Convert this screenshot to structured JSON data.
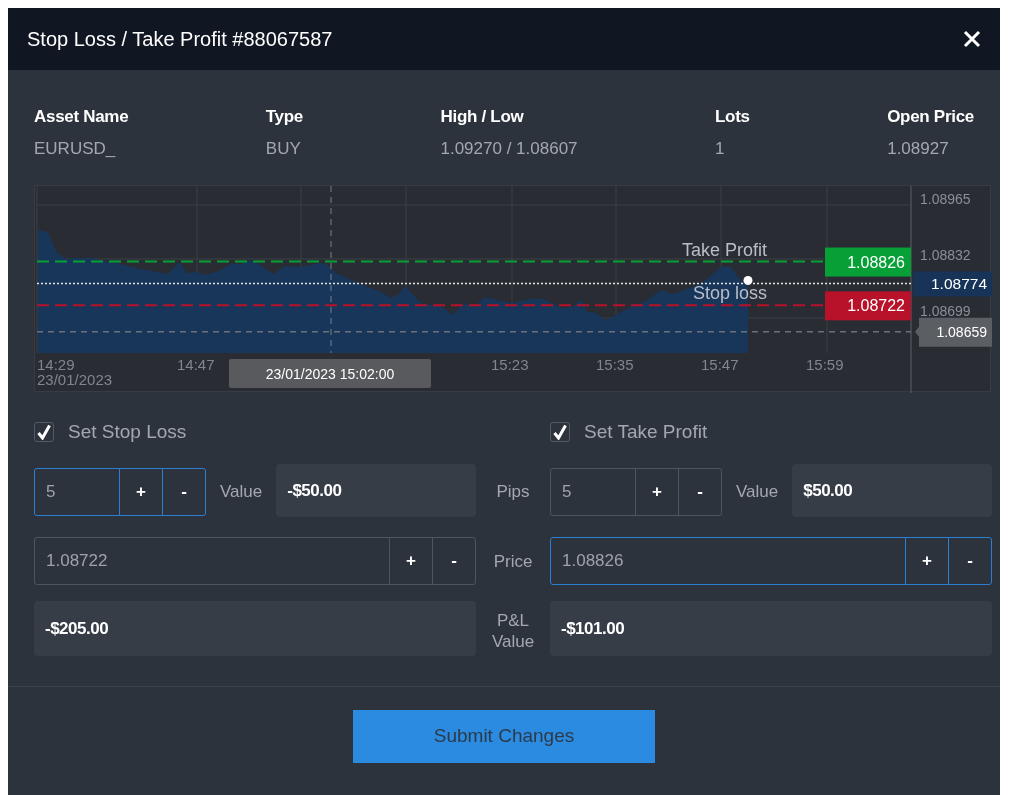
{
  "dialog": {
    "title": "Stop Loss / Take Profit #88067587"
  },
  "summary": [
    {
      "label": "Asset Name",
      "value": "EURUSD_"
    },
    {
      "label": "Type",
      "value": "BUY"
    },
    {
      "label": "High / Low",
      "value": "1.09270 / 1.08607"
    },
    {
      "label": "Lots",
      "value": "1"
    },
    {
      "label": "Open Price",
      "value": "1.08927"
    }
  ],
  "chart": {
    "price_ticks": [
      "1.08965",
      "1.08832",
      "1.08699"
    ],
    "time_ticks": [
      {
        "time": "14:29",
        "date": "23/01/2023"
      },
      {
        "time": "14:47"
      },
      {
        "time": "15:23"
      },
      {
        "time": "15:35"
      },
      {
        "time": "15:47"
      },
      {
        "time": "15:59"
      }
    ],
    "levels": [
      {
        "kind": "take_profit",
        "label": "Take Profit",
        "price": "1.08826",
        "color": "#07a037"
      },
      {
        "kind": "stop_loss",
        "label": "Stop loss",
        "price": "1.08722",
        "color": "#b8112a"
      }
    ],
    "current_price": "1.08774",
    "open_marker": "1.08659",
    "crosshair_time": "23/01/2023 15:02:00"
  },
  "stop_loss": {
    "label": "Set Stop Loss",
    "checked": true,
    "pips": {
      "value": "5",
      "focused": true,
      "buttons": [
        "+",
        "-"
      ]
    },
    "value_label": "Value",
    "value": "-$50.00",
    "price": {
      "value": "1.08722",
      "focused": false,
      "buttons": [
        "+",
        "-"
      ]
    },
    "pnl": "-$205.00"
  },
  "row_labels": [
    "Pips",
    "Price",
    "P&L Value"
  ],
  "take_profit": {
    "label": "Set Take Profit",
    "checked": true,
    "pips": {
      "value": "5",
      "focused": false,
      "buttons": [
        "+",
        "-"
      ]
    },
    "value_label": "Value",
    "value": "$50.00",
    "price": {
      "value": "1.08826",
      "focused": true,
      "buttons": [
        "+",
        "-"
      ]
    },
    "pnl": "-$101.00"
  },
  "submit": "Submit Changes"
}
